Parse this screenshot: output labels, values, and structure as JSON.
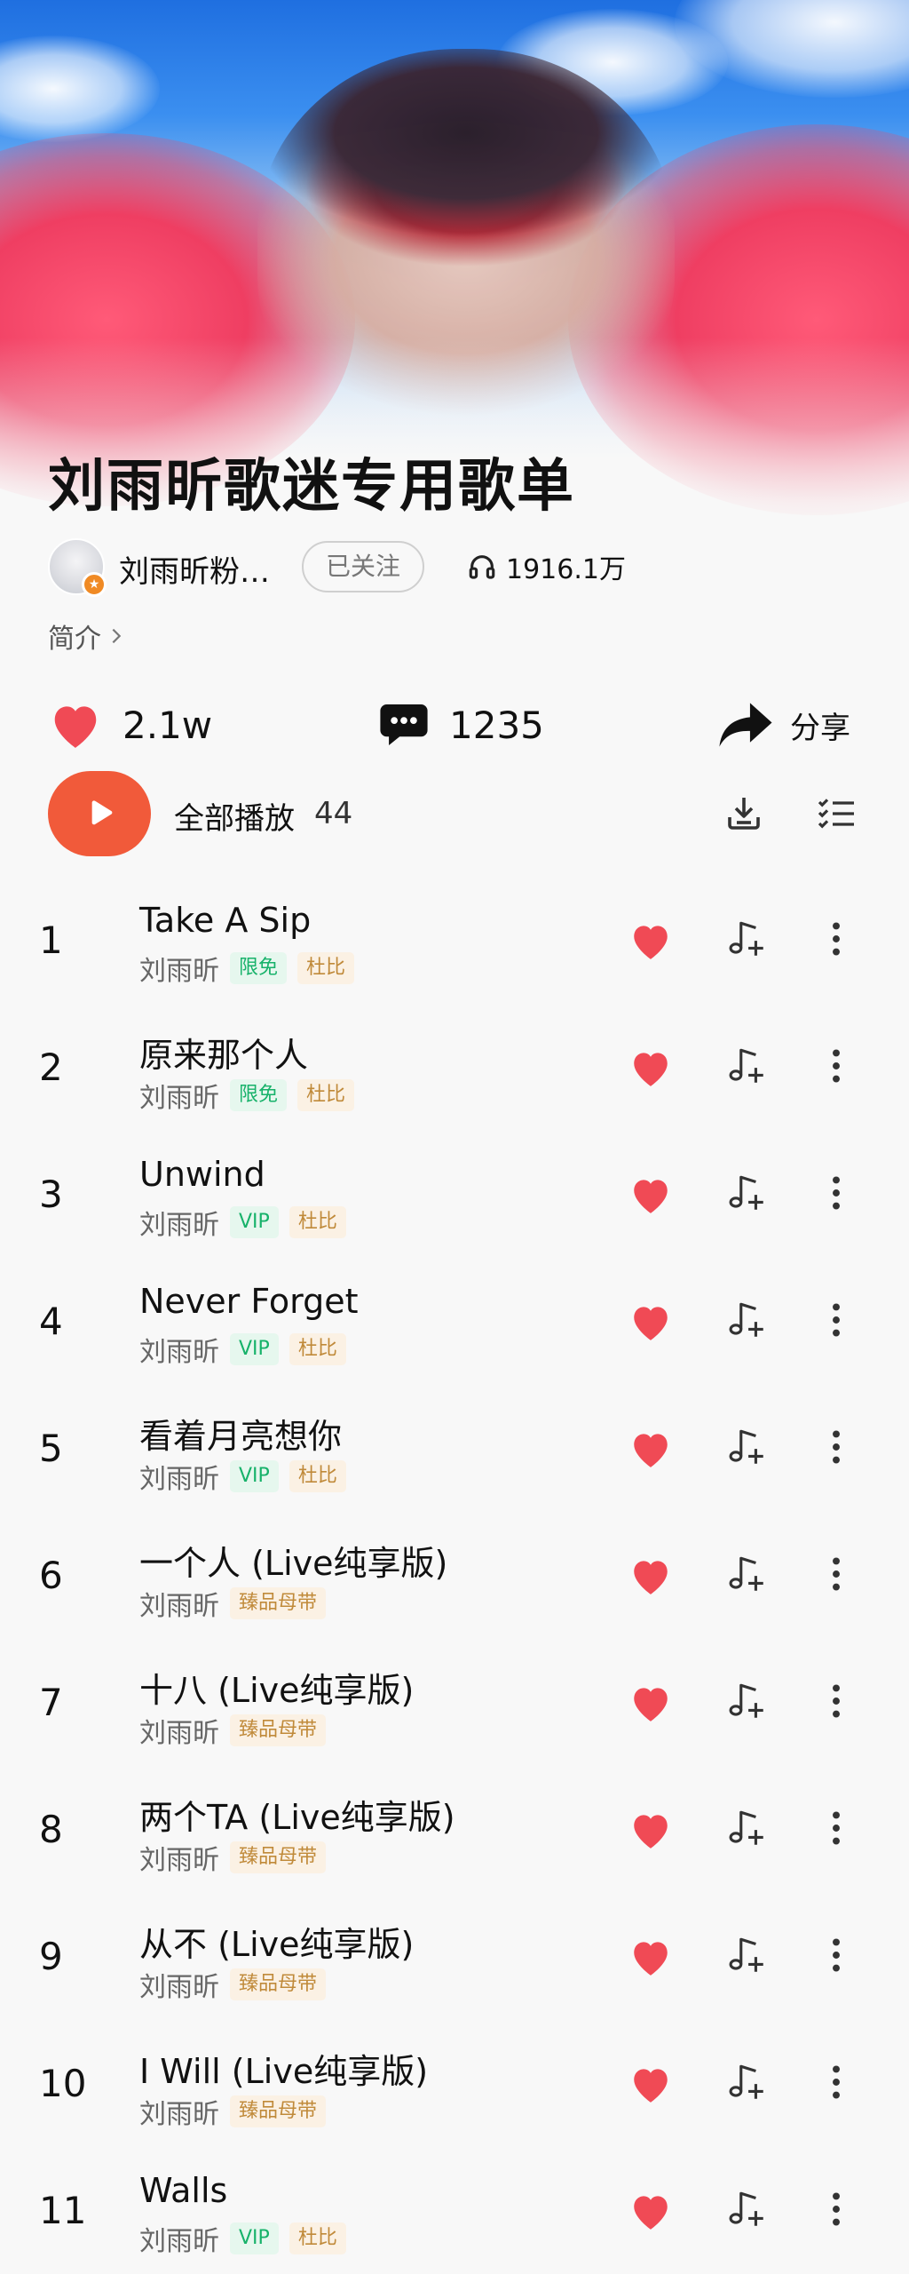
{
  "playlist": {
    "title": "刘雨昕歌迷专用歌单",
    "creator_name": "刘雨昕粉丝团",
    "follow_label": "已关注",
    "plays": "1916.1万",
    "intro_label": "简介"
  },
  "actions": {
    "likes": "2.1w",
    "comments": "1235",
    "share_label": "分享",
    "play_all_label": "全部播放",
    "song_count": "44"
  },
  "colors": {
    "accent": "#f15a3a",
    "heart": "#f04a55",
    "vip_green": "#17b26a",
    "gold": "#c08a3a"
  },
  "songs": [
    {
      "index": "1",
      "title": "Take A Sip",
      "artist": "刘雨昕",
      "tags": [
        {
          "text": "限免",
          "style": "green"
        },
        {
          "text": "杜比",
          "style": "gold"
        }
      ]
    },
    {
      "index": "2",
      "title": "原来那个人",
      "artist": "刘雨昕",
      "tags": [
        {
          "text": "限免",
          "style": "green"
        },
        {
          "text": "杜比",
          "style": "gold"
        }
      ]
    },
    {
      "index": "3",
      "title": "Unwind",
      "artist": "刘雨昕",
      "tags": [
        {
          "text": "VIP",
          "style": "green"
        },
        {
          "text": "杜比",
          "style": "gold"
        }
      ]
    },
    {
      "index": "4",
      "title": "Never Forget",
      "artist": "刘雨昕",
      "tags": [
        {
          "text": "VIP",
          "style": "green"
        },
        {
          "text": "杜比",
          "style": "gold"
        }
      ]
    },
    {
      "index": "5",
      "title": "看着月亮想你",
      "artist": "刘雨昕",
      "tags": [
        {
          "text": "VIP",
          "style": "green"
        },
        {
          "text": "杜比",
          "style": "gold"
        }
      ]
    },
    {
      "index": "6",
      "title": "一个人 (Live纯享版)",
      "artist": "刘雨昕",
      "tags": [
        {
          "text": "臻品母带",
          "style": "gold"
        }
      ]
    },
    {
      "index": "7",
      "title": "十八 (Live纯享版)",
      "artist": "刘雨昕",
      "tags": [
        {
          "text": "臻品母带",
          "style": "gold"
        }
      ]
    },
    {
      "index": "8",
      "title": "两个TA (Live纯享版)",
      "artist": "刘雨昕",
      "tags": [
        {
          "text": "臻品母带",
          "style": "gold"
        }
      ]
    },
    {
      "index": "9",
      "title": "从不 (Live纯享版)",
      "artist": "刘雨昕",
      "tags": [
        {
          "text": "臻品母带",
          "style": "gold"
        }
      ]
    },
    {
      "index": "10",
      "title": "I Will (Live纯享版)",
      "artist": "刘雨昕",
      "tags": [
        {
          "text": "臻品母带",
          "style": "gold"
        }
      ]
    },
    {
      "index": "11",
      "title": "Walls",
      "artist": "刘雨昕",
      "tags": [
        {
          "text": "VIP",
          "style": "green"
        },
        {
          "text": "杜比",
          "style": "gold"
        }
      ]
    }
  ]
}
